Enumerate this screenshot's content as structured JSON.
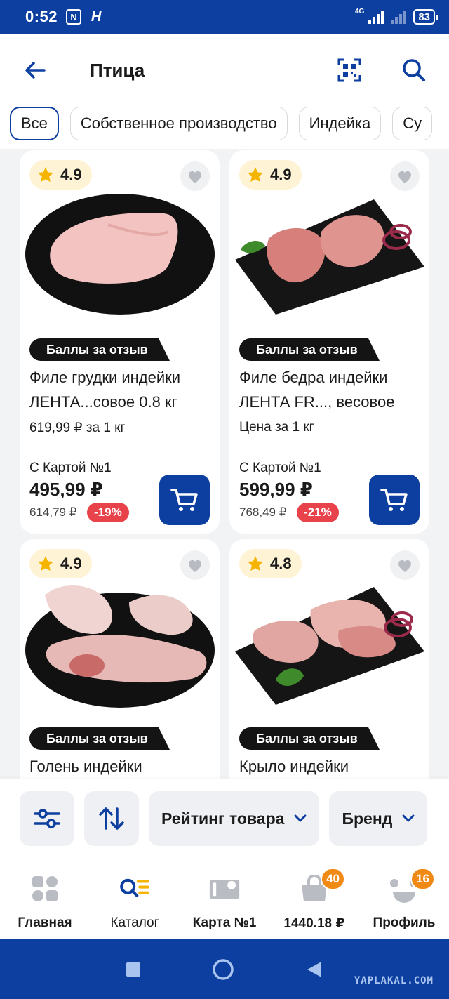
{
  "status_bar": {
    "time": "0:52",
    "network": "4G",
    "battery": "83"
  },
  "header": {
    "title": "Птица"
  },
  "chips": [
    {
      "label": "Все",
      "active": true
    },
    {
      "label": "Собственное производство",
      "active": false
    },
    {
      "label": "Индейка",
      "active": false
    },
    {
      "label": "Су",
      "active": false
    }
  ],
  "products": [
    {
      "rating": "4.9",
      "review_badge": "Баллы за отзыв",
      "name_line1": "Филе грудки индейки",
      "name_line2": "ЛЕНТА...совое 0.8 кг",
      "unit_price": "619,99 ₽ за 1 кг",
      "card_label": "С Картой №1",
      "price": "495,99 ₽",
      "old_price": "614,79 ₽",
      "discount": "-19%"
    },
    {
      "rating": "4.9",
      "review_badge": "Баллы за отзыв",
      "name_line1": "Филе бедра индейки",
      "name_line2": "ЛЕНТА FR..., весовое",
      "unit_price": "Цена за 1 кг",
      "card_label": "С Картой №1",
      "price": "599,99 ₽",
      "old_price": "768,49 ₽",
      "discount": "-21%"
    },
    {
      "rating": "4.9",
      "review_badge": "Баллы за отзыв",
      "name_line1": "Голень индейки"
    },
    {
      "rating": "4.8",
      "review_badge": "Баллы за отзыв",
      "name_line1": "Крыло индейки"
    }
  ],
  "sort_bar": {
    "rating_filter": "Рейтинг товара",
    "brand_filter": "Бренд"
  },
  "bottom_nav": {
    "home": "Главная",
    "catalog": "Каталог",
    "card": "Карта №1",
    "cart": "1440.18 ₽",
    "cart_badge": "40",
    "profile": "Профиль",
    "profile_badge": "16"
  },
  "watermark": "YAPLAKAL.COM",
  "colors": {
    "brand_blue": "#0d3fa0",
    "discount_red": "#e8434b",
    "badge_orange": "#f08a14",
    "rating_bg": "#fff3d6"
  }
}
